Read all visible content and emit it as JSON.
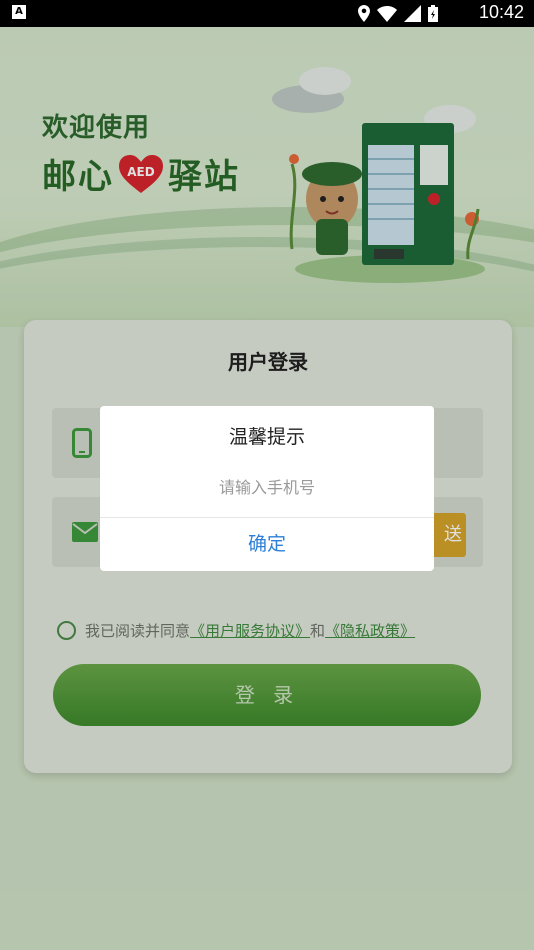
{
  "status_bar": {
    "time": "10:42",
    "left_badge": "A"
  },
  "banner": {
    "welcome": "欢迎使用",
    "brand_left": "邮心",
    "brand_heart": "AED",
    "brand_right": "驿站"
  },
  "login_card": {
    "title": "用户登录",
    "send_code_label": "送",
    "agree_prefix": "我已阅读并同意",
    "user_agreement": "《用户服务协议》",
    "agree_and": "和",
    "privacy_policy": "《隐私政策》",
    "login_button": "登 录"
  },
  "dialog": {
    "title": "温馨提示",
    "message": "请输入手机号",
    "confirm": "确定"
  },
  "colors": {
    "brand_green": "#3e8a2c",
    "dialog_link": "#2d7fd8",
    "send_orange": "#d4a32a"
  }
}
